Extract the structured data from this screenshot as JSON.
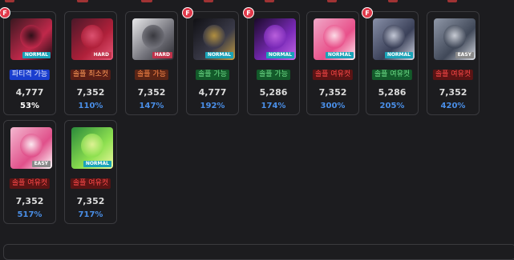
{
  "bosses": [
    {
      "status": "파티격 가능",
      "status_style": "party",
      "difficulty": "NORMAL",
      "hp": "4,777",
      "percent": "53%",
      "percent_style": "white",
      "fav": "F",
      "palette": [
        "#3a1820",
        "#c0284a",
        "#1a0c12"
      ]
    },
    {
      "status": "솔플 최소컷",
      "status_style": "min",
      "difficulty": "HARD",
      "hp": "7,352",
      "percent": "110%",
      "percent_style": "blue",
      "fav": "",
      "palette": [
        "#4a1828",
        "#b0203a",
        "#e85a7a"
      ]
    },
    {
      "status": "솔플 가능",
      "status_style": "possible-orange",
      "difficulty": "HARD",
      "hp": "7,352",
      "percent": "147%",
      "percent_style": "blue",
      "fav": "",
      "palette": [
        "#e8e8ea",
        "#707078",
        "#2a2a30"
      ]
    },
    {
      "status": "솔플 가능",
      "status_style": "possible-green",
      "difficulty": "NORMAL",
      "hp": "4,777",
      "percent": "192%",
      "percent_style": "blue",
      "fav": "F",
      "palette": [
        "#101014",
        "#3a3a48",
        "#c8a040"
      ]
    },
    {
      "status": "솔플 가능",
      "status_style": "possible-green",
      "difficulty": "NORMAL",
      "hp": "5,286",
      "percent": "174%",
      "percent_style": "blue",
      "fav": "F",
      "palette": [
        "#1a0a2a",
        "#7a2ab8",
        "#c86ae8"
      ]
    },
    {
      "status": "솔플 여유컷",
      "status_style": "room",
      "difficulty": "NORMAL",
      "hp": "7,352",
      "percent": "300%",
      "percent_style": "blue",
      "fav": "",
      "palette": [
        "#f0a8c8",
        "#e8508a",
        "#fff0f4"
      ]
    },
    {
      "status": "솔플 여유컷",
      "status_style": "possible-green",
      "difficulty": "NORMAL",
      "hp": "5,286",
      "percent": "205%",
      "percent_style": "blue",
      "fav": "F",
      "palette": [
        "#8890a8",
        "#3a4058",
        "#d8dce8"
      ]
    },
    {
      "status": "솔플 여유컷",
      "status_style": "room",
      "difficulty": "EASY",
      "hp": "7,352",
      "percent": "420%",
      "percent_style": "blue",
      "fav": "",
      "palette": [
        "#9098a8",
        "#404858",
        "#dcdfe6"
      ]
    },
    {
      "status": "솔플 여유컷",
      "status_style": "room",
      "difficulty": "EASY",
      "hp": "7,352",
      "percent": "517%",
      "percent_style": "blue",
      "fav": "",
      "palette": [
        "#f4b8d0",
        "#e0508a",
        "#ffffff"
      ]
    },
    {
      "status": "솔플 여유컷",
      "status_style": "room",
      "difficulty": "NORMAL",
      "hp": "7,352",
      "percent": "717%",
      "percent_style": "blue",
      "fav": "",
      "palette": [
        "#2a8a3a",
        "#8ee050",
        "#f0f8a0"
      ]
    }
  ]
}
